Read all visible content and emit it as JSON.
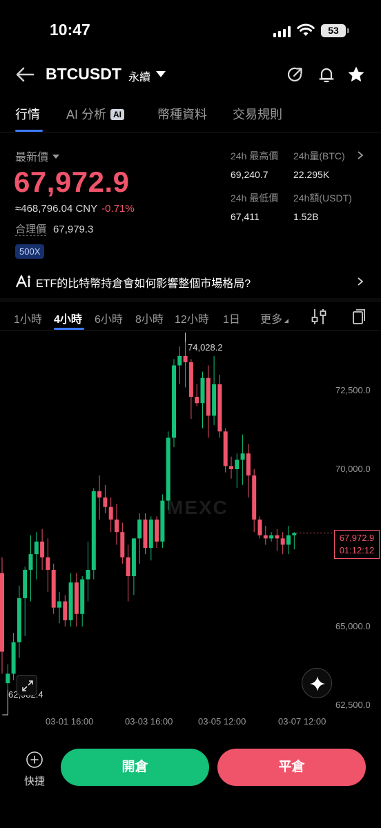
{
  "status_bar": {
    "time": "10:47",
    "battery": "53"
  },
  "header": {
    "symbol": "BTCUSDT",
    "contract_type": "永續"
  },
  "tabs": [
    {
      "label": "行情",
      "active": true
    },
    {
      "label": "AI 分析",
      "badge": "AI"
    },
    {
      "label": "幣種資料"
    },
    {
      "label": "交易規則"
    }
  ],
  "ticker": {
    "price_label": "最新價",
    "last_price": "67,972.9",
    "cny_value": "≈468,796.04 CNY",
    "change_pct": "-0.71%",
    "fair_price_label": "合理價",
    "fair_price": "67,979.3",
    "leverage_badge": "500X"
  },
  "stats": {
    "high_label": "24h 最高價",
    "high_value": "69,240.7",
    "vol_btc_label": "24h量(BTC)",
    "vol_btc_value": "22.295K",
    "low_label": "24h 最低價",
    "low_value": "67,411",
    "vol_usdt_label": "24h額(USDT)",
    "vol_usdt_value": "1.52B"
  },
  "promo": {
    "text": "ETF的比特幣持倉會如何影響整個市場格局?"
  },
  "intervals": [
    {
      "label": "1小時"
    },
    {
      "label": "4小時",
      "active": true
    },
    {
      "label": "6小時"
    },
    {
      "label": "8小時"
    },
    {
      "label": "12小時"
    },
    {
      "label": "1日"
    },
    {
      "label": "更多"
    }
  ],
  "chart": {
    "watermark": "MEXC",
    "y_ticks": [
      "72,500.0",
      "70,000.0",
      "65,000.0",
      "62,500.0"
    ],
    "x_ticks": [
      "03-01 16:00",
      "03-03 16:00",
      "03-05 12:00",
      "03-07 12:00"
    ],
    "high_marker": "74,028.2",
    "low_marker": "62,982.4",
    "current_price": "67,972.9",
    "countdown": "01:12:12",
    "colors": {
      "up": "#15c079",
      "down": "#f0546b"
    }
  },
  "chart_data": {
    "type": "candlestick",
    "x": [
      "03-01 16:00",
      "03-03 16:00",
      "03-05 12:00",
      "03-07 12:00"
    ],
    "ylim": [
      62000,
      74500
    ],
    "y_ticks": [
      62500,
      65000,
      70000,
      72500
    ],
    "series": [
      {
        "candles": [
          {
            "o": 66700,
            "h": 67200,
            "l": 63500,
            "c": 64200
          },
          {
            "o": 63200,
            "h": 63800,
            "l": 62982.4,
            "c": 63500
          },
          {
            "o": 63500,
            "h": 64800,
            "l": 63300,
            "c": 64500
          },
          {
            "o": 64500,
            "h": 66300,
            "l": 64000,
            "c": 65900
          },
          {
            "o": 65900,
            "h": 66900,
            "l": 64700,
            "c": 66800
          },
          {
            "o": 66800,
            "h": 67900,
            "l": 65800,
            "c": 67300
          },
          {
            "o": 67300,
            "h": 68000,
            "l": 66500,
            "c": 67700
          },
          {
            "o": 67700,
            "h": 68100,
            "l": 66800,
            "c": 67200
          },
          {
            "o": 67200,
            "h": 67800,
            "l": 66100,
            "c": 66800
          },
          {
            "o": 66800,
            "h": 67000,
            "l": 65400,
            "c": 65600
          },
          {
            "o": 65600,
            "h": 66100,
            "l": 65100,
            "c": 65800
          },
          {
            "o": 65800,
            "h": 66000,
            "l": 65000,
            "c": 65200
          },
          {
            "o": 65200,
            "h": 66700,
            "l": 65000,
            "c": 66400
          },
          {
            "o": 66400,
            "h": 66700,
            "l": 65000,
            "c": 65400
          },
          {
            "o": 65400,
            "h": 66600,
            "l": 65000,
            "c": 66500
          },
          {
            "o": 66500,
            "h": 67700,
            "l": 65800,
            "c": 66800
          },
          {
            "o": 66800,
            "h": 69400,
            "l": 66500,
            "c": 69300
          },
          {
            "o": 69300,
            "h": 69800,
            "l": 68400,
            "c": 69100
          },
          {
            "o": 69100,
            "h": 69500,
            "l": 68600,
            "c": 68800
          },
          {
            "o": 68800,
            "h": 69100,
            "l": 68000,
            "c": 68400
          },
          {
            "o": 68400,
            "h": 68900,
            "l": 67600,
            "c": 68000
          },
          {
            "o": 68000,
            "h": 68300,
            "l": 67000,
            "c": 67200
          },
          {
            "o": 67200,
            "h": 67600,
            "l": 65800,
            "c": 66600
          },
          {
            "o": 66600,
            "h": 67800,
            "l": 66000,
            "c": 67800
          },
          {
            "o": 67800,
            "h": 68600,
            "l": 67000,
            "c": 68400
          },
          {
            "o": 68400,
            "h": 68600,
            "l": 67300,
            "c": 67500
          },
          {
            "o": 67500,
            "h": 68500,
            "l": 67100,
            "c": 68400
          },
          {
            "o": 68400,
            "h": 68500,
            "l": 67500,
            "c": 67700
          },
          {
            "o": 67700,
            "h": 69200,
            "l": 67500,
            "c": 69000
          },
          {
            "o": 69000,
            "h": 71200,
            "l": 68700,
            "c": 71000
          },
          {
            "o": 71000,
            "h": 73500,
            "l": 70700,
            "c": 73300
          },
          {
            "o": 73300,
            "h": 73900,
            "l": 72700,
            "c": 73600
          },
          {
            "o": 73600,
            "h": 74028.2,
            "l": 72600,
            "c": 73400
          },
          {
            "o": 73400,
            "h": 73500,
            "l": 71600,
            "c": 72300
          },
          {
            "o": 72300,
            "h": 72700,
            "l": 72000,
            "c": 72100
          },
          {
            "o": 72100,
            "h": 73100,
            "l": 71300,
            "c": 72900
          },
          {
            "o": 72900,
            "h": 73300,
            "l": 71000,
            "c": 71700
          },
          {
            "o": 71700,
            "h": 73600,
            "l": 71400,
            "c": 72700
          },
          {
            "o": 72700,
            "h": 73000,
            "l": 71000,
            "c": 71200
          },
          {
            "o": 71200,
            "h": 71300,
            "l": 69900,
            "c": 70100
          },
          {
            "o": 70100,
            "h": 70400,
            "l": 69700,
            "c": 70000
          },
          {
            "o": 70000,
            "h": 70500,
            "l": 69400,
            "c": 70300
          },
          {
            "o": 70300,
            "h": 71100,
            "l": 69500,
            "c": 70500
          },
          {
            "o": 70500,
            "h": 70800,
            "l": 69100,
            "c": 69800
          },
          {
            "o": 69800,
            "h": 70000,
            "l": 68000,
            "c": 68400
          },
          {
            "o": 68400,
            "h": 68500,
            "l": 67800,
            "c": 67900
          },
          {
            "o": 67900,
            "h": 68200,
            "l": 67600,
            "c": 67800
          },
          {
            "o": 67800,
            "h": 68000,
            "l": 67700,
            "c": 67900
          },
          {
            "o": 67900,
            "h": 68100,
            "l": 67400,
            "c": 67800
          },
          {
            "o": 67800,
            "h": 68000,
            "l": 67300,
            "c": 67600
          },
          {
            "o": 67600,
            "h": 68200,
            "l": 67300,
            "c": 67900
          },
          {
            "o": 67900,
            "h": 68000,
            "l": 67450,
            "c": 67972.9
          }
        ]
      }
    ]
  },
  "bottom": {
    "quick_label": "快捷",
    "open_label": "開倉",
    "close_label": "平倉"
  }
}
